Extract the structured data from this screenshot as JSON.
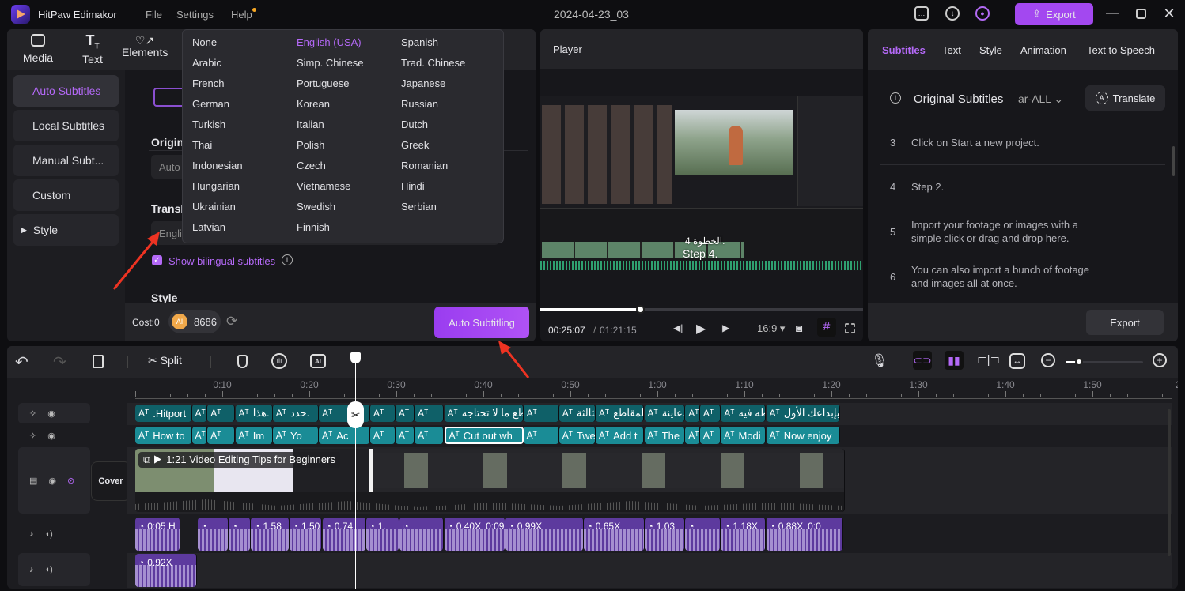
{
  "app": {
    "name": "HitPaw Edimakor",
    "menu": [
      "File",
      "Settings",
      "Help"
    ],
    "project_title": "2024-04-23_03",
    "export_label": "Export",
    "accent": "#a45cf5"
  },
  "toolbar": {
    "tabs": [
      "Media",
      "Text",
      "Elements"
    ]
  },
  "sidebar": {
    "items": [
      "Auto Subtitles",
      "Local Subtitles",
      "Manual Subt...",
      "Custom",
      "Style"
    ],
    "active": 0
  },
  "subtitle_panel": {
    "original_label": "Origin",
    "original_value": "Auto",
    "translate_label": "Transl",
    "translate_value": "Engli",
    "bilingual_label": "Show bilingual subtitles",
    "bilingual_checked": true,
    "style_label": "Style",
    "cost_label": "Cost:0",
    "ai_badge": "AI",
    "credits": "8686",
    "auto_button": "Auto Subtitling"
  },
  "language_dropdown": {
    "selected": "English (USA)",
    "options": [
      [
        "None",
        "English (USA)",
        "Spanish"
      ],
      [
        "Arabic",
        "Simp. Chinese",
        "Trad. Chinese"
      ],
      [
        "French",
        "Portuguese",
        "Japanese"
      ],
      [
        "German",
        "Korean",
        "Russian"
      ],
      [
        "Turkish",
        "Italian",
        "Dutch"
      ],
      [
        "Thai",
        "Polish",
        "Greek"
      ],
      [
        "Indonesian",
        "Czech",
        "Romanian"
      ],
      [
        "Hungarian",
        "Vietnamese",
        "Hindi"
      ],
      [
        "Ukrainian",
        "Swedish",
        "Serbian"
      ],
      [
        "Latvian",
        "Finnish",
        ""
      ]
    ]
  },
  "player": {
    "title": "Player",
    "current_time": "00:25:07",
    "total_time": "01:21:15",
    "progress": 0.31,
    "aspect": "16:9",
    "overlay_ar": "الخطوة 4.",
    "overlay_en": "Step 4."
  },
  "right_panel": {
    "tabs": [
      "Subtitles",
      "Text",
      "Style",
      "Animation",
      "Text to Speech"
    ],
    "active_tab": 0,
    "heading": "Original Subtitles",
    "lang": "ar-ALL",
    "translate": "Translate",
    "export": "Export",
    "rows": [
      {
        "n": "3",
        "text": "Click on Start a new project."
      },
      {
        "n": "4",
        "text": "Step 2."
      },
      {
        "n": "5",
        "text": "Import your footage or images with a simple click or drag and drop here."
      },
      {
        "n": "6",
        "text": "You can also import a bunch of footage and images all at once."
      }
    ]
  },
  "timeline": {
    "split_label": "Split",
    "cover_label": "Cover",
    "playhead_sec": 25.3,
    "zoom_level": 0.05,
    "ruler": [
      "0:10",
      "0:20",
      "0:30",
      "0:40",
      "0:50",
      "1:00",
      "1:10",
      "1:20",
      "1:30",
      "1:40",
      "1:50",
      "2:"
    ],
    "video_clip": {
      "title": "1:21 Video Editing Tips for Beginners",
      "start": 0,
      "end": 81.5
    },
    "subtitle_bounds": [
      0,
      6.5,
      8.3,
      11.5,
      15.8,
      21.1,
      27,
      29.9,
      32.1,
      35.5,
      44.6,
      48.7,
      52.9,
      58.5,
      63.2,
      64.9,
      67.3,
      72.5,
      81
    ],
    "subtitles_ar": [
      ".Hitport",
      "",
      "",
      "هذا.",
      "حدد.",
      "",
      "",
      "",
      "",
      "قطع ما لا تحتاجه.",
      "",
      "الثالثة.",
      "المقاطع.",
      "عاينة.",
      "",
      "",
      "قطه فيه.",
      "بإبداعك الأول!"
    ],
    "subtitles_en": [
      "How to",
      "",
      "",
      "Im",
      "Yo",
      "Ac",
      "",
      "",
      "",
      "Cut out wh",
      "",
      "Twe",
      "Add t",
      "The",
      "",
      "",
      "Modi",
      "Now enjoy"
    ],
    "selected_en": 9,
    "audio1": [
      {
        "s": 0,
        "e": 5.2,
        "l": "0:05 H"
      },
      {
        "s": 7.2,
        "e": 10.7,
        "l": ""
      },
      {
        "s": 10.7,
        "e": 13.3,
        "l": ""
      },
      {
        "s": 13.3,
        "e": 17.7,
        "l": "1.58"
      },
      {
        "s": 17.7,
        "e": 21.5,
        "l": "1.50"
      },
      {
        "s": 21.5,
        "e": 26.5,
        "l": "0.74"
      },
      {
        "s": 26.5,
        "e": 30.4,
        "l": "1."
      },
      {
        "s": 30.4,
        "e": 35.5,
        "l": ""
      },
      {
        "s": 35.5,
        "e": 42.5,
        "l": "0.40X",
        "l2": "0:09"
      },
      {
        "s": 42.5,
        "e": 51.5,
        "l": "0.99X"
      },
      {
        "s": 51.5,
        "e": 58.5,
        "l": "0.65X"
      },
      {
        "s": 58.5,
        "e": 63.2,
        "l": "1.03"
      },
      {
        "s": 63.2,
        "e": 67.3,
        "l": ""
      },
      {
        "s": 67.3,
        "e": 72.5,
        "l": "1.18X"
      },
      {
        "s": 72.5,
        "e": 81.4,
        "l": "0.88X",
        "l2": "0:0"
      }
    ],
    "audio2": [
      {
        "s": 0,
        "e": 7.1,
        "l": "0.92X"
      }
    ]
  }
}
